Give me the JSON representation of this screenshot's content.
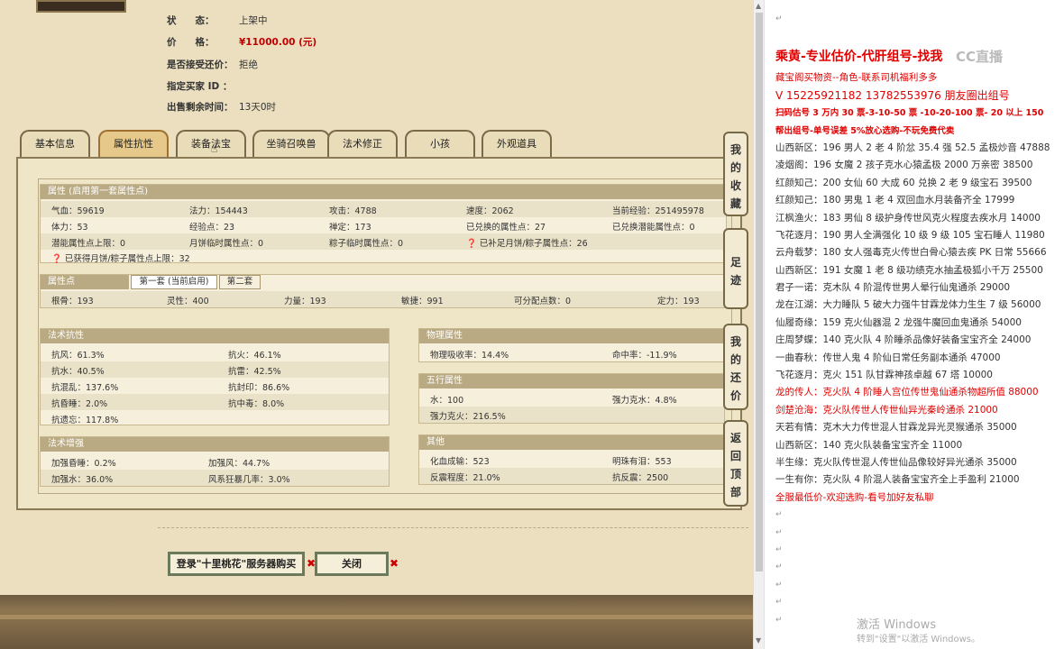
{
  "info": {
    "status_label": "状　　态：",
    "status_value": "上架中",
    "price_label": "价　　格：",
    "price_value": "¥11000.00 (元)",
    "bargain_label": "是否接受还价：",
    "bargain_value": "拒绝",
    "buyer_label": "指定买家 ID ：",
    "buyer_value": "",
    "time_label": "出售剩余时间：",
    "time_value": "13天0时"
  },
  "tabs": [
    "基本信息",
    "属性抗性",
    "装备法宝",
    "坐骑召唤兽",
    "法术修正",
    "小孩",
    "外观道具"
  ],
  "active_tab": "属性抗性",
  "attr": {
    "header": "属性 (启用第一套属性点)",
    "cells": [
      "气血：59619",
      "法力：154443",
      "攻击：4788",
      "速度：2062",
      "当前经验：251495978",
      "体力：53",
      "经验点：23",
      "禅定：173",
      "已兑换的属性点：27",
      "已兑换潜能属性点：0",
      "潜能属性点上限：0",
      "月饼临时属性点：0",
      "粽子临时属性点：0",
      "已补足月饼/粽子属性点：26",
      "已获得月饼/粽子属性点上限：32"
    ]
  },
  "points": {
    "header": "属性点",
    "subtab1": "第一套 (当前启用)",
    "subtab2": "第二套",
    "cells": [
      "根骨：193",
      "灵性：400",
      "力量：193",
      "敏捷：991",
      "可分配点数：0",
      "定力：193"
    ]
  },
  "resist": {
    "header": "法术抗性",
    "cells": [
      "抗风：61.3%",
      "抗火：46.1%",
      "抗水：40.5%",
      "抗雷：42.5%",
      "抗混乱：137.6%",
      "抗封印：86.6%",
      "抗昏睡：2.0%",
      "抗中毒：8.0%",
      "抗遗忘：117.8%"
    ]
  },
  "enhance": {
    "header": "法术增强",
    "cells": [
      "加强昏睡：0.2%",
      "加强风：44.7%",
      "加强水：36.0%",
      "风系狂暴几率：3.0%"
    ]
  },
  "physical": {
    "header": "物理属性",
    "cells": [
      "物理吸收率：14.4%",
      "命中率：-11.9%"
    ]
  },
  "five": {
    "header": "五行属性",
    "cells": [
      "水：100",
      "强力克水：4.8%",
      "强力克火：216.5%"
    ]
  },
  "other": {
    "header": "其他",
    "cells": [
      "化血成输：523",
      "明珠有泪：553",
      "反震程度：21.0%",
      "抗反震：2500"
    ]
  },
  "side_buttons": [
    "我的收藏",
    "足迹",
    "我的还价",
    "返回顶部"
  ],
  "bottom_buttons": {
    "login": "登录\"十里桃花\"服务器购买",
    "close": "关闭"
  },
  "right_lines": [
    {
      "t": "乘黄-专业估价-代肝组号-找我",
      "c": "red",
      "big": true
    },
    {
      "t": "藏宝阁买物资--角色-联系司机福利多多",
      "c": "red"
    },
    {
      "t": "V 15225921182   13782553976 朋友圈出组号",
      "c": "red",
      "big2": true
    },
    {
      "t": "扫码估号 3 万内 30 票-3-10-50 票  -10-20-100 票- 20 以上 150",
      "c": "red",
      "bold": true
    },
    {
      "t": "帮出组号-单号误差 5%放心选购-不玩免费代卖",
      "c": "red",
      "bold": true
    },
    {
      "t": "山西新区：196 男人 2 老 4 阶忿 35.4 强 52.5 孟极炒音 47888",
      "c": "black"
    },
    {
      "t": "凌烟阁：196 女魔 2 孩子克水心猿孟极 2000 万亲密 38500",
      "c": "black"
    },
    {
      "t": "红颜知己：200 女仙 60 大成 60 兑换 2 老 9 级宝石 39500",
      "c": "black"
    },
    {
      "t": "红颜知己：180 男鬼 1 老 4 双回血水月装备齐全 17999",
      "c": "black"
    },
    {
      "t": "江枫渔火：183 男仙 8 级护身传世风克火程度去疾水月 14000",
      "c": "black"
    },
    {
      "t": "飞花逐月：190 男人全满强化 10 级 9 级 105 宝石睡人 11980",
      "c": "black"
    },
    {
      "t": "云舟载梦：180 女人强毒克火传世白骨心猿去疾 PK 日常 55666",
      "c": "black"
    },
    {
      "t": "山西新区：191 女魔 1 老 8 级功绩克水抽孟极狐小千万 25500",
      "c": "black"
    },
    {
      "t": "君子一诺：克木队 4 阶混传世男人晕行仙鬼通杀 29000",
      "c": "black"
    },
    {
      "t": "龙在江湖：大力睡队 5 破大力强牛甘霖龙体力生生 7 级 56000",
      "c": "black"
    },
    {
      "t": "仙履奇缘：159 克火仙器混 2 龙强牛魔回血鬼通杀 54000",
      "c": "black"
    },
    {
      "t": "庄周梦蝶：140 克火队 4 阶睡杀品像好装备宝宝齐全 24000",
      "c": "black"
    },
    {
      "t": "一曲春秋：传世人鬼 4 阶仙日常任务副本通杀 47000",
      "c": "black"
    },
    {
      "t": "飞花逐月：克火 151 队甘霖神孩卓越 67 塔 10000",
      "c": "black"
    },
    {
      "t": "龙的传人：克火队 4 阶睡人宫位传世鬼仙通杀物超所值 88000",
      "c": "red"
    },
    {
      "t": "剑楚沧海：克火队传世人传世仙异光秦岭通杀 21000",
      "c": "red"
    },
    {
      "t": "天若有情：克木大力传世混人甘霖龙异光灵猴通杀 35000",
      "c": "black"
    },
    {
      "t": "山西新区：140 克火队装备宝宝齐全 11000",
      "c": "black"
    },
    {
      "t": "半生缘：克火队传世混人传世仙品像较好异光通杀 35000",
      "c": "black"
    },
    {
      "t": "一生有你：克火队 4 阶混人装备宝宝齐全上手盈利 21000",
      "c": "black"
    },
    {
      "t": "全服最低价-欢迎选购-看号加好友私聊",
      "c": "red"
    }
  ],
  "watermark": {
    "line1": "激活 Windows",
    "line2": "转到\"设置\"以激活 Windows。"
  },
  "logo_text": "CC直播",
  "colors": {
    "red": "#e00000",
    "panel_header": "#b9aa84",
    "bg": "#ebdfc0"
  }
}
